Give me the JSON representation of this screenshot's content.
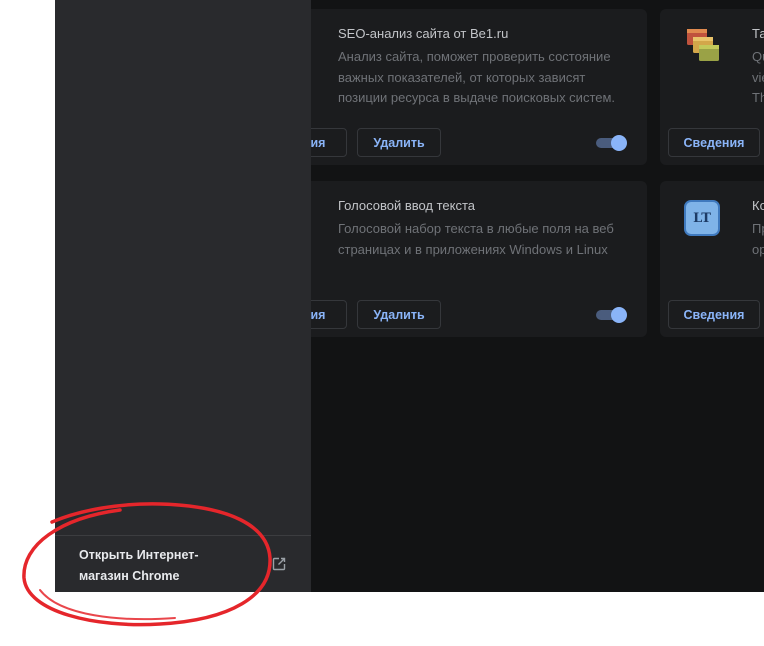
{
  "extensions": [
    {
      "title": "SEO-анализ сайта от Be1.ru",
      "description": "Анализ сайта, поможет проверить состояние важных показателей, от которых зависят позиции ресурса в выдаче поисковых систем.",
      "details_label": "Сведения",
      "remove_label": "Удалить",
      "enabled": true
    },
    {
      "title": "Голосовой ввод текста",
      "description": "Голосовой набор текста в любые поля на веб страницах и в приложениях Windows и Linux",
      "details_label": "Сведения",
      "remove_label": "Удалить",
      "enabled": true
    },
    {
      "title": "Та",
      "description": "Qu vie Th",
      "details_label": "Сведения",
      "icon": "tab-manager-icon"
    },
    {
      "title": "Ко",
      "description": "Пр ор",
      "details_label": "Сведения",
      "icon": "languagetool-icon",
      "icon_text": "LT"
    }
  ],
  "sidebar": {
    "store_link": "Открыть Интернет-магазин Chrome",
    "store_link_icon": "open-in-new-icon"
  },
  "annotation": {
    "highlight_color": "#e5262b"
  }
}
